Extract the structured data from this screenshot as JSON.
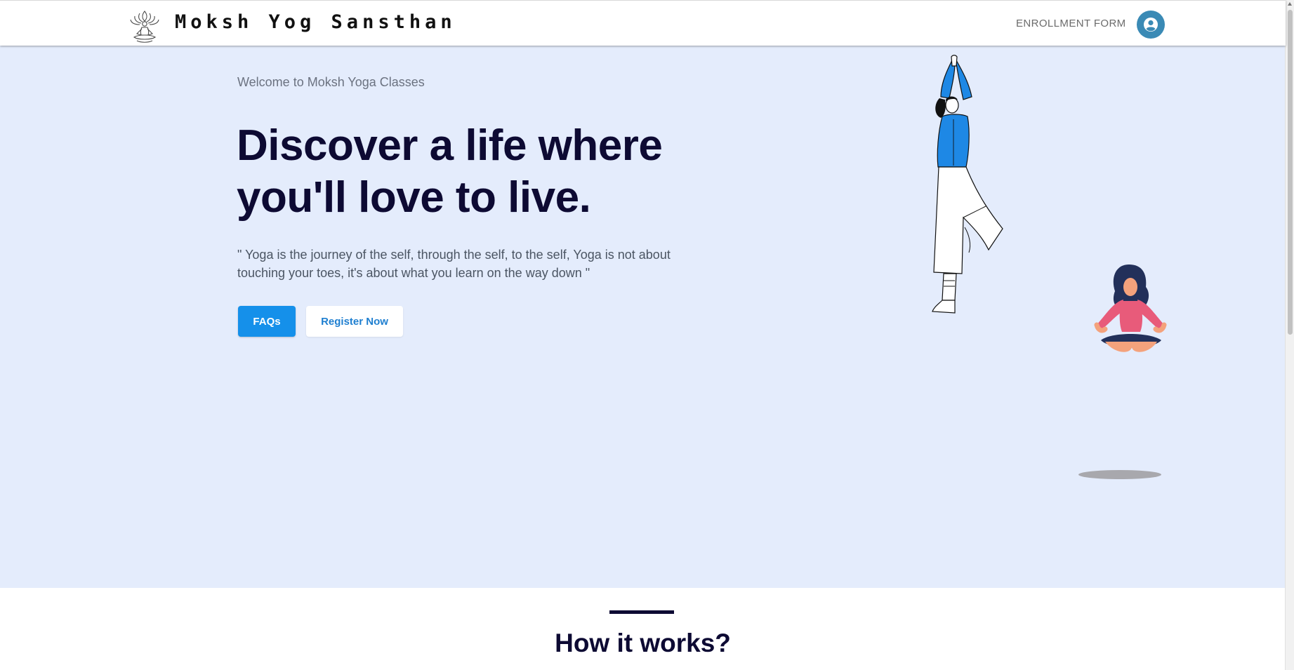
{
  "header": {
    "brand": "Moksh Yog Sansthan",
    "nav_link": "ENROLLMENT FORM",
    "logo_icon": "lotus-meditation-icon",
    "account_icon": "user-circle-icon",
    "account_color": "#3a8ab5"
  },
  "hero": {
    "welcome": "Welcome to Moksh Yoga Classes",
    "headline": "Discover a life where you'll love to live.",
    "quote": "\" Yoga is the journey of the self, through the self, to the self, Yoga is not about touching your toes, it's about what you learn on the way down \"",
    "faq_button": "FAQs",
    "register_button": "Register Now",
    "background_color": "#e4ecfc",
    "primary_color": "#1590ea",
    "heading_color": "#0d0a33"
  },
  "how": {
    "title": "How it works?"
  }
}
